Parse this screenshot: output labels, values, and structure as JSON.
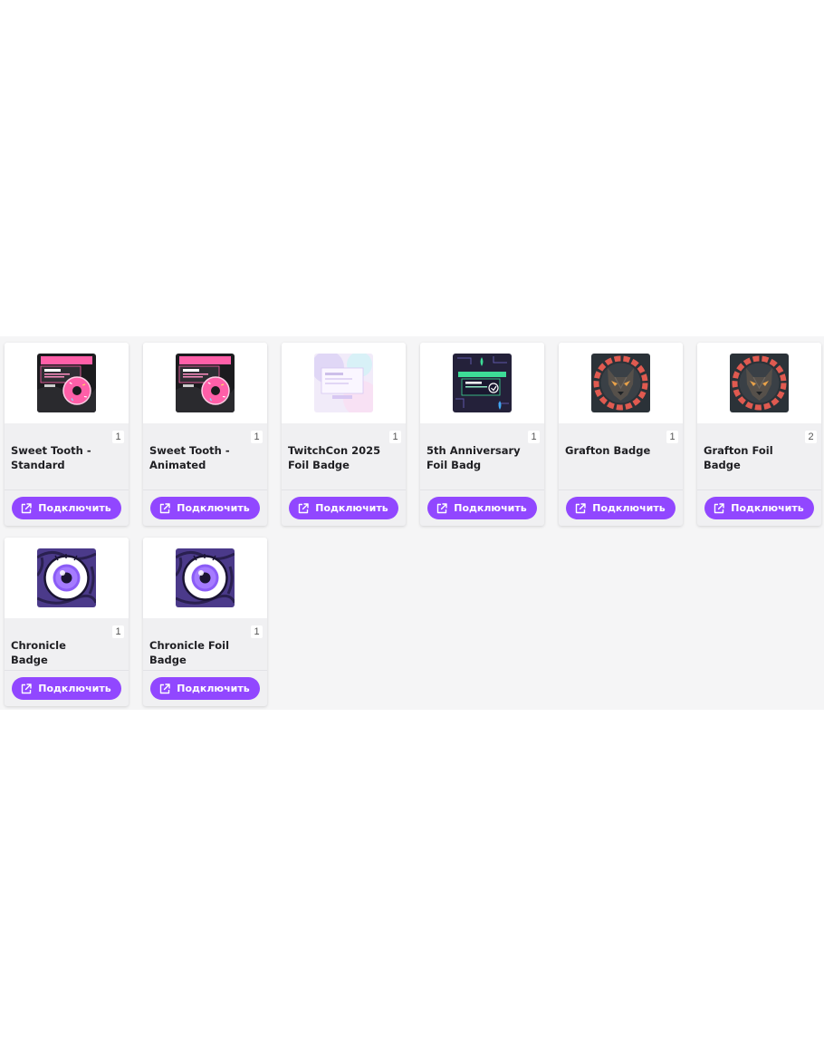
{
  "button_label": "Подключить",
  "colors": {
    "accent": "#9147ff",
    "panel_bg": "#f5f5f6",
    "card_bg": "#f0f0f2"
  },
  "cards": [
    {
      "title": "Sweet Tooth - Standard",
      "quantity": "1",
      "image": "sweet-tooth-donut-card"
    },
    {
      "title": "Sweet Tooth - Animated",
      "quantity": "1",
      "image": "sweet-tooth-donut-card"
    },
    {
      "title": "TwitchCon 2025 Foil Badge",
      "quantity": "1",
      "image": "holographic-foil-card"
    },
    {
      "title": "5th Anniversary Foil Badg",
      "quantity": "1",
      "image": "anniversary-circuit-card"
    },
    {
      "title": "Grafton Badge",
      "quantity": "1",
      "image": "wolf-emblem"
    },
    {
      "title": "Grafton Foil Badge",
      "quantity": "2",
      "image": "wolf-emblem"
    },
    {
      "title": "Chronicle Badge",
      "quantity": "1",
      "image": "purple-eye"
    },
    {
      "title": "Chronicle Foil Badge",
      "quantity": "1",
      "image": "purple-eye"
    }
  ]
}
